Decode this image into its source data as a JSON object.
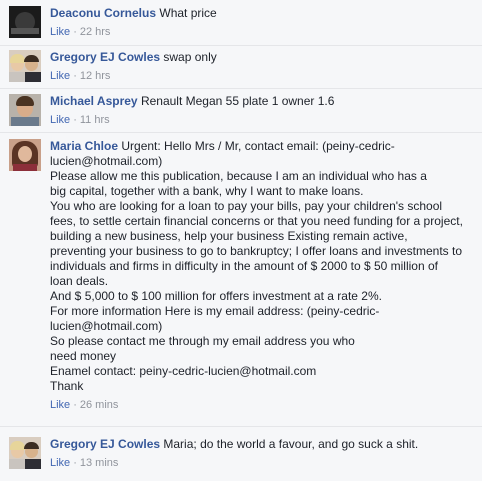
{
  "comments": [
    {
      "author": "Deaconu Cornelus",
      "text": "What price",
      "like_label": "Like",
      "separator": "·",
      "time": "22 hrs",
      "avatar_icon": "profile-photo-dark"
    },
    {
      "author": "Gregory EJ Cowles",
      "text": "swap only",
      "like_label": "Like",
      "separator": "·",
      "time": "12 hrs",
      "avatar_icon": "profile-photo-couple"
    },
    {
      "author": "Michael Asprey",
      "text": "Renault Megan 55 plate 1 owner 1.6",
      "like_label": "Like",
      "separator": "·",
      "time": "11 hrs",
      "avatar_icon": "profile-photo-man"
    },
    {
      "author": "Maria Chloe",
      "text": "Urgent: Hello Mrs / Mr, contact email: (peiny-cedric-\nlucien@hotmail.com)\nPlease allow me this publication, because I am an individual who has a\nbig capital, together with a bank, why I want to make loans.\nYou who are looking for a loan to pay your bills, pay your children's school\nfees, to settle certain financial concerns or that you need funding for a project,\nbuilding a new business, help your business Existing remain active,\npreventing your business to go to bankruptcy; I offer loans and investments to\nindividuals and firms in difficulty in the amount of $ 2000 to $ 50 million of\nloan deals.\nAnd $ 5,000 to $ 100 million for offers investment at a rate 2%.\nFor more information Here is my email address: (peiny-cedric-\nlucien@hotmail.com)\nSo please contact me through my email address you who\nneed money\nEnamel contact: peiny-cedric-lucien@hotmail.com\nThank",
      "like_label": "Like",
      "separator": "·",
      "time": "26 mins",
      "avatar_icon": "profile-photo-woman"
    },
    {
      "author": "Gregory EJ Cowles",
      "text": "Maria; do the world a favour, and go suck a shit.",
      "like_label": "Like",
      "separator": "·",
      "time": "13 mins",
      "avatar_icon": "profile-photo-couple"
    }
  ],
  "colors": {
    "background": "#f6f7f9",
    "author": "#365899",
    "link": "#4267b2",
    "meta": "#90949c",
    "text": "#1d2129"
  }
}
